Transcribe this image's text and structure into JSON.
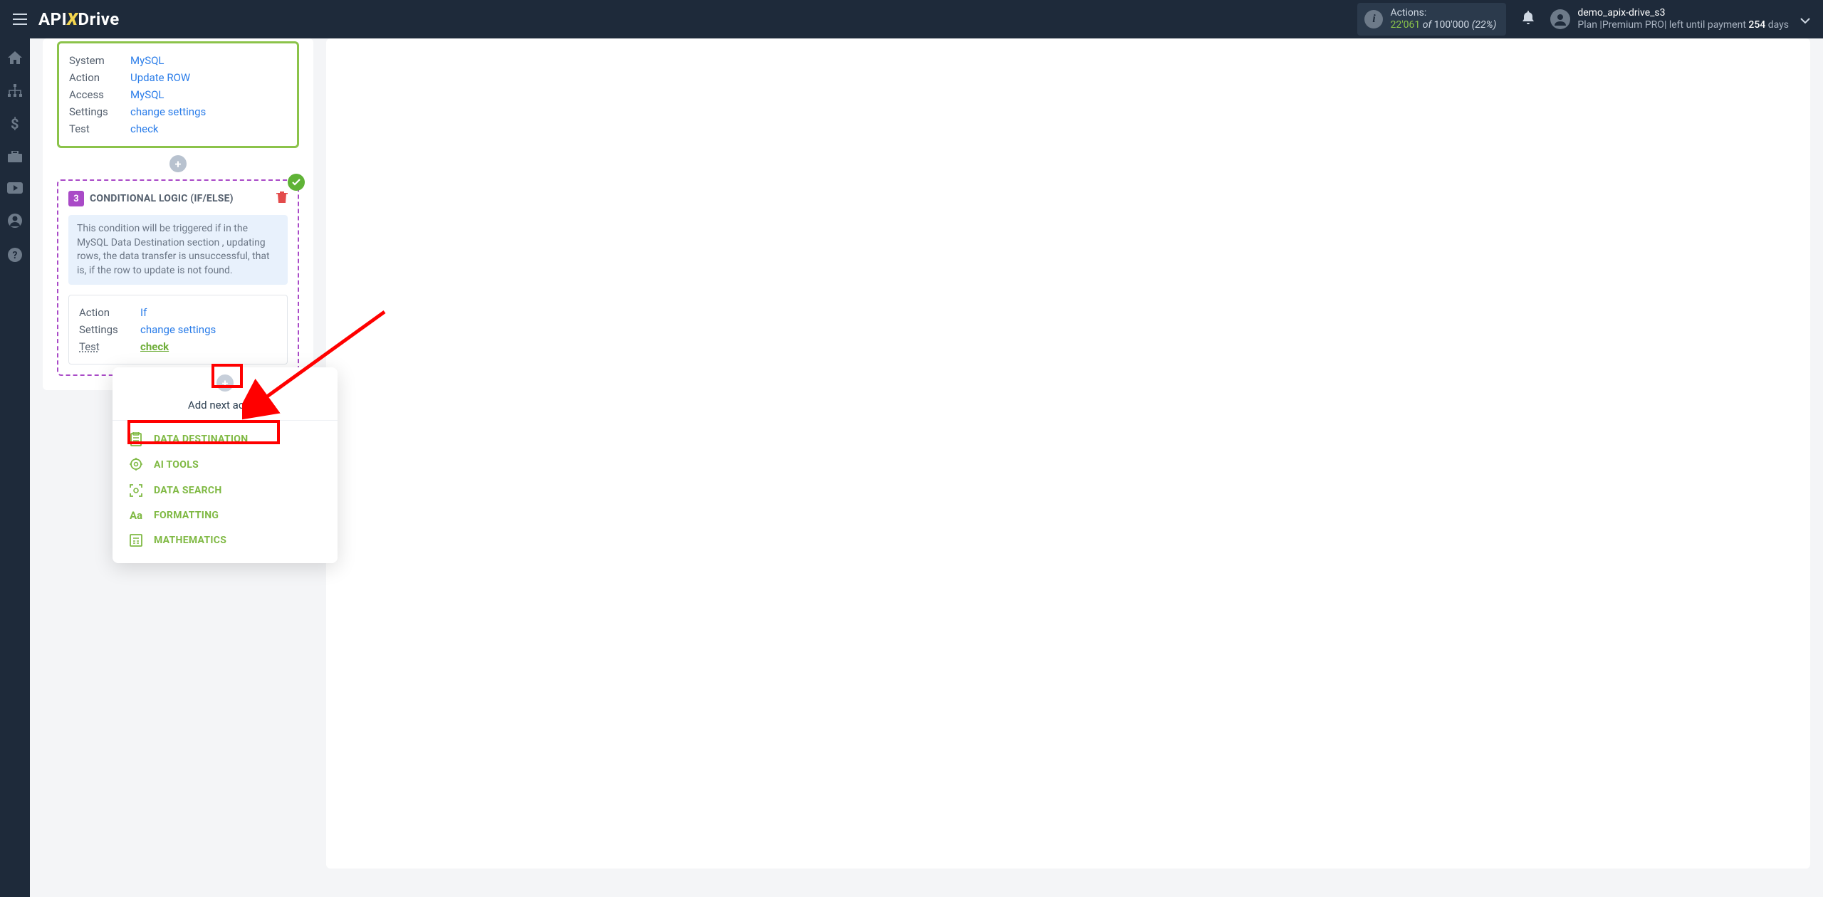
{
  "header": {
    "logo_api": "API",
    "logo_x": "X",
    "logo_drive": "Drive",
    "actions_label": "Actions:",
    "actions_current": "22'061",
    "actions_of": " of ",
    "actions_max": "100'000",
    "actions_pct": "(22%)",
    "user_name": "demo_apix-drive_s3",
    "plan_prefix": "Plan |Premium PRO| left until payment ",
    "plan_days": "254",
    "plan_suffix": " days"
  },
  "block1": {
    "rows": [
      {
        "label": "System",
        "value": "MySQL"
      },
      {
        "label": "Action",
        "value": "Update ROW"
      },
      {
        "label": "Access",
        "value": "MySQL"
      },
      {
        "label": "Settings",
        "value": "change settings"
      },
      {
        "label": "Test",
        "value": "check"
      }
    ]
  },
  "block2": {
    "step_num": "3",
    "title": "CONDITIONAL LOGIC (IF/ELSE)",
    "description": "This condition will be triggered if in the MySQL Data Destination section , updating rows, the data transfer is unsuccessful, that is, if the row to update is not found.",
    "rows": [
      {
        "label": "Action",
        "value": "If"
      },
      {
        "label": "Settings",
        "value": "change settings"
      },
      {
        "label": "Test",
        "value": "check"
      }
    ]
  },
  "dropdown": {
    "header": "Add next action",
    "items": [
      {
        "label": "DATA DESTINATION",
        "icon": "clipboard"
      },
      {
        "label": "AI TOOLS",
        "icon": "gear-head"
      },
      {
        "label": "DATA SEARCH",
        "icon": "scan"
      },
      {
        "label": "FORMATTING",
        "icon": "aa"
      },
      {
        "label": "MATHEMATICS",
        "icon": "calc"
      }
    ]
  }
}
